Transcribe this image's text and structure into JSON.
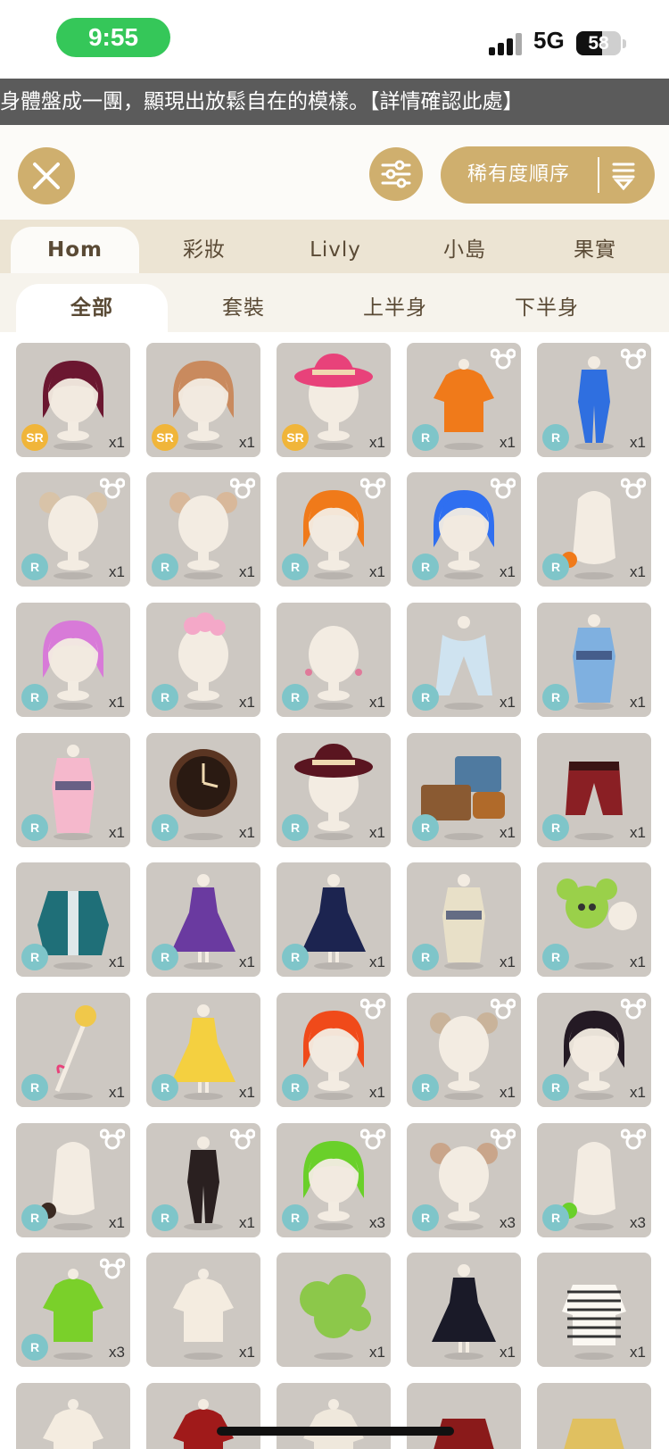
{
  "status": {
    "time": "9:55",
    "network": "5G",
    "battery": "58",
    "battery_level": 0.58
  },
  "ticker": "身體盤成一團，顯現出放鬆自在的模樣。【詳情確認此處】",
  "toolbar": {
    "sort_label": "稀有度順序"
  },
  "category_tabs": [
    {
      "label": "Hom",
      "active": true
    },
    {
      "label": "彩妝",
      "active": false
    },
    {
      "label": "Livly",
      "active": false
    },
    {
      "label": "小島",
      "active": false
    },
    {
      "label": "果實",
      "active": false
    }
  ],
  "sub_tabs": [
    {
      "label": "全部",
      "active": true
    },
    {
      "label": "套裝",
      "active": false
    },
    {
      "label": "上半身",
      "active": false
    },
    {
      "label": "下半身",
      "active": false
    }
  ],
  "colors": {
    "gold": "#cfaf6e",
    "rarity_r": "#7fc5c9",
    "rarity_sr": "#f0b53a",
    "card_bg": "#cdc8c2"
  },
  "items": [
    {
      "rarity": "SR",
      "qty": "x1",
      "kind": "hair",
      "color": "#6b1730",
      "mouse": false
    },
    {
      "rarity": "SR",
      "qty": "x1",
      "kind": "hair",
      "color": "#c98a5e",
      "mouse": false
    },
    {
      "rarity": "SR",
      "qty": "x1",
      "kind": "hat",
      "color": "#e8427a",
      "mouse": false
    },
    {
      "rarity": "R",
      "qty": "x1",
      "kind": "top",
      "color": "#f07a1a",
      "mouse": true
    },
    {
      "rarity": "R",
      "qty": "x1",
      "kind": "outfit",
      "color": "#2f6fe0",
      "mouse": true
    },
    {
      "rarity": "R",
      "qty": "x1",
      "kind": "ears",
      "color": "#d8c3a8",
      "mouse": true
    },
    {
      "rarity": "R",
      "qty": "x1",
      "kind": "ears",
      "color": "#d8b89a",
      "mouse": true
    },
    {
      "rarity": "R",
      "qty": "x1",
      "kind": "hair",
      "color": "#f07a1a",
      "mouse": true
    },
    {
      "rarity": "R",
      "qty": "x1",
      "kind": "hair",
      "color": "#2f6ff0",
      "mouse": true
    },
    {
      "rarity": "R",
      "qty": "x1",
      "kind": "tail",
      "color": "#f07a1a",
      "mouse": true
    },
    {
      "rarity": "R",
      "qty": "x1",
      "kind": "hair",
      "color": "#d87ad8",
      "mouse": false
    },
    {
      "rarity": "R",
      "qty": "x1",
      "kind": "flower",
      "color": "#f4a8c8",
      "mouse": false
    },
    {
      "rarity": "R",
      "qty": "x1",
      "kind": "head",
      "color": "#f0e8e0",
      "mouse": false
    },
    {
      "rarity": "R",
      "qty": "x1",
      "kind": "scarf",
      "color": "#cfe3f0",
      "mouse": false
    },
    {
      "rarity": "R",
      "qty": "x1",
      "kind": "kimono",
      "color": "#7fb0e0",
      "mouse": false
    },
    {
      "rarity": "R",
      "qty": "x1",
      "kind": "kimono",
      "color": "#f5b8cc",
      "mouse": false
    },
    {
      "rarity": "R",
      "qty": "x1",
      "kind": "clock",
      "color": "#5a3522",
      "mouse": false
    },
    {
      "rarity": "R",
      "qty": "x1",
      "kind": "hat",
      "color": "#5a1520",
      "mouse": false
    },
    {
      "rarity": "R",
      "qty": "x1",
      "kind": "suitcase",
      "color": "#4f7aa0",
      "mouse": false
    },
    {
      "rarity": "R",
      "qty": "x1",
      "kind": "pants",
      "color": "#8a1f24",
      "mouse": false
    },
    {
      "rarity": "R",
      "qty": "x1",
      "kind": "coat",
      "color": "#1f6f78",
      "mouse": false
    },
    {
      "rarity": "R",
      "qty": "x1",
      "kind": "dress",
      "color": "#6a3aa0",
      "mouse": false
    },
    {
      "rarity": "R",
      "qty": "x1",
      "kind": "dress",
      "color": "#1c2450",
      "mouse": false
    },
    {
      "rarity": "R",
      "qty": "x1",
      "kind": "kimono",
      "color": "#e8e0c8",
      "mouse": false
    },
    {
      "rarity": "R",
      "qty": "x1",
      "kind": "plush",
      "color": "#9ad04a",
      "mouse": false
    },
    {
      "rarity": "R",
      "qty": "x1",
      "kind": "wand",
      "color": "#f0c84a",
      "mouse": false
    },
    {
      "rarity": "R",
      "qty": "x1",
      "kind": "dress",
      "color": "#f4d040",
      "mouse": false
    },
    {
      "rarity": "R",
      "qty": "x1",
      "kind": "hair",
      "color": "#f04a1a",
      "mouse": true
    },
    {
      "rarity": "R",
      "qty": "x1",
      "kind": "ears",
      "color": "#c9b39a",
      "mouse": true
    },
    {
      "rarity": "R",
      "qty": "x1",
      "kind": "hair",
      "color": "#241a24",
      "mouse": true
    },
    {
      "rarity": "R",
      "qty": "x1",
      "kind": "tail",
      "color": "#3a2a22",
      "mouse": true
    },
    {
      "rarity": "R",
      "qty": "x1",
      "kind": "outfit",
      "color": "#2a2020",
      "mouse": true
    },
    {
      "rarity": "R",
      "qty": "x3",
      "kind": "hair",
      "color": "#6ad02a",
      "mouse": true
    },
    {
      "rarity": "R",
      "qty": "x3",
      "kind": "ears",
      "color": "#c9a58a",
      "mouse": true
    },
    {
      "rarity": "R",
      "qty": "x3",
      "kind": "tail",
      "color": "#6ad02a",
      "mouse": true
    },
    {
      "rarity": "R",
      "qty": "x3",
      "kind": "top",
      "color": "#7ad02a",
      "mouse": true
    },
    {
      "rarity": "",
      "qty": "x1",
      "kind": "top",
      "color": "#f4ece0",
      "mouse": false
    },
    {
      "rarity": "",
      "qty": "x1",
      "kind": "bush",
      "color": "#8cc84a",
      "mouse": false
    },
    {
      "rarity": "",
      "qty": "x1",
      "kind": "dress",
      "color": "#1a1a28",
      "mouse": false
    },
    {
      "rarity": "",
      "qty": "x1",
      "kind": "stripe",
      "color": "#333333",
      "mouse": false
    },
    {
      "rarity": "",
      "qty": "",
      "kind": "top",
      "color": "#f4ece0",
      "mouse": false
    },
    {
      "rarity": "",
      "qty": "",
      "kind": "top",
      "color": "#a01a1a",
      "mouse": false
    },
    {
      "rarity": "",
      "qty": "",
      "kind": "top",
      "color": "#efe8dc",
      "mouse": false
    },
    {
      "rarity": "",
      "qty": "",
      "kind": "skirt",
      "color": "#8a1a1a",
      "mouse": false
    },
    {
      "rarity": "",
      "qty": "",
      "kind": "skirt",
      "color": "#e0c060",
      "mouse": false
    }
  ]
}
